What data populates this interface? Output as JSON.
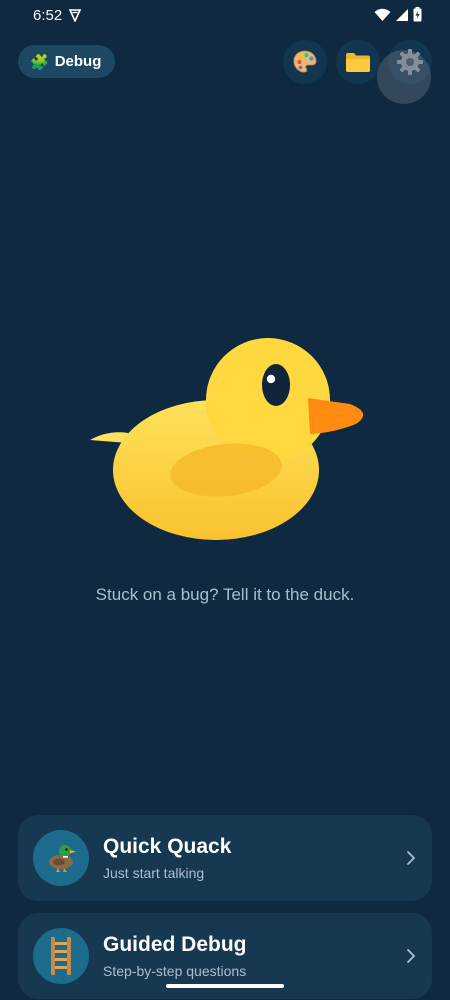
{
  "status_bar": {
    "time": "6:52"
  },
  "top_bar": {
    "chip_label": "Debug",
    "chip_emoji": "🧩"
  },
  "main": {
    "tagline": "Stuck on a bug? Tell it to the duck."
  },
  "cards": [
    {
      "title": "Quick Quack",
      "subtitle": "Just start talking",
      "icon": "duck-emoji-icon"
    },
    {
      "title": "Guided Debug",
      "subtitle": "Step-by-step questions",
      "icon": "ladder-emoji-icon"
    }
  ],
  "colors": {
    "background": "#0f2a40",
    "card": "#173851",
    "chip": "#1e4763",
    "avatar": "#1d6b8d",
    "duck_body": "#fdd33f",
    "duck_beak": "#ff8a00",
    "muted_text": "#a9bfd0"
  }
}
